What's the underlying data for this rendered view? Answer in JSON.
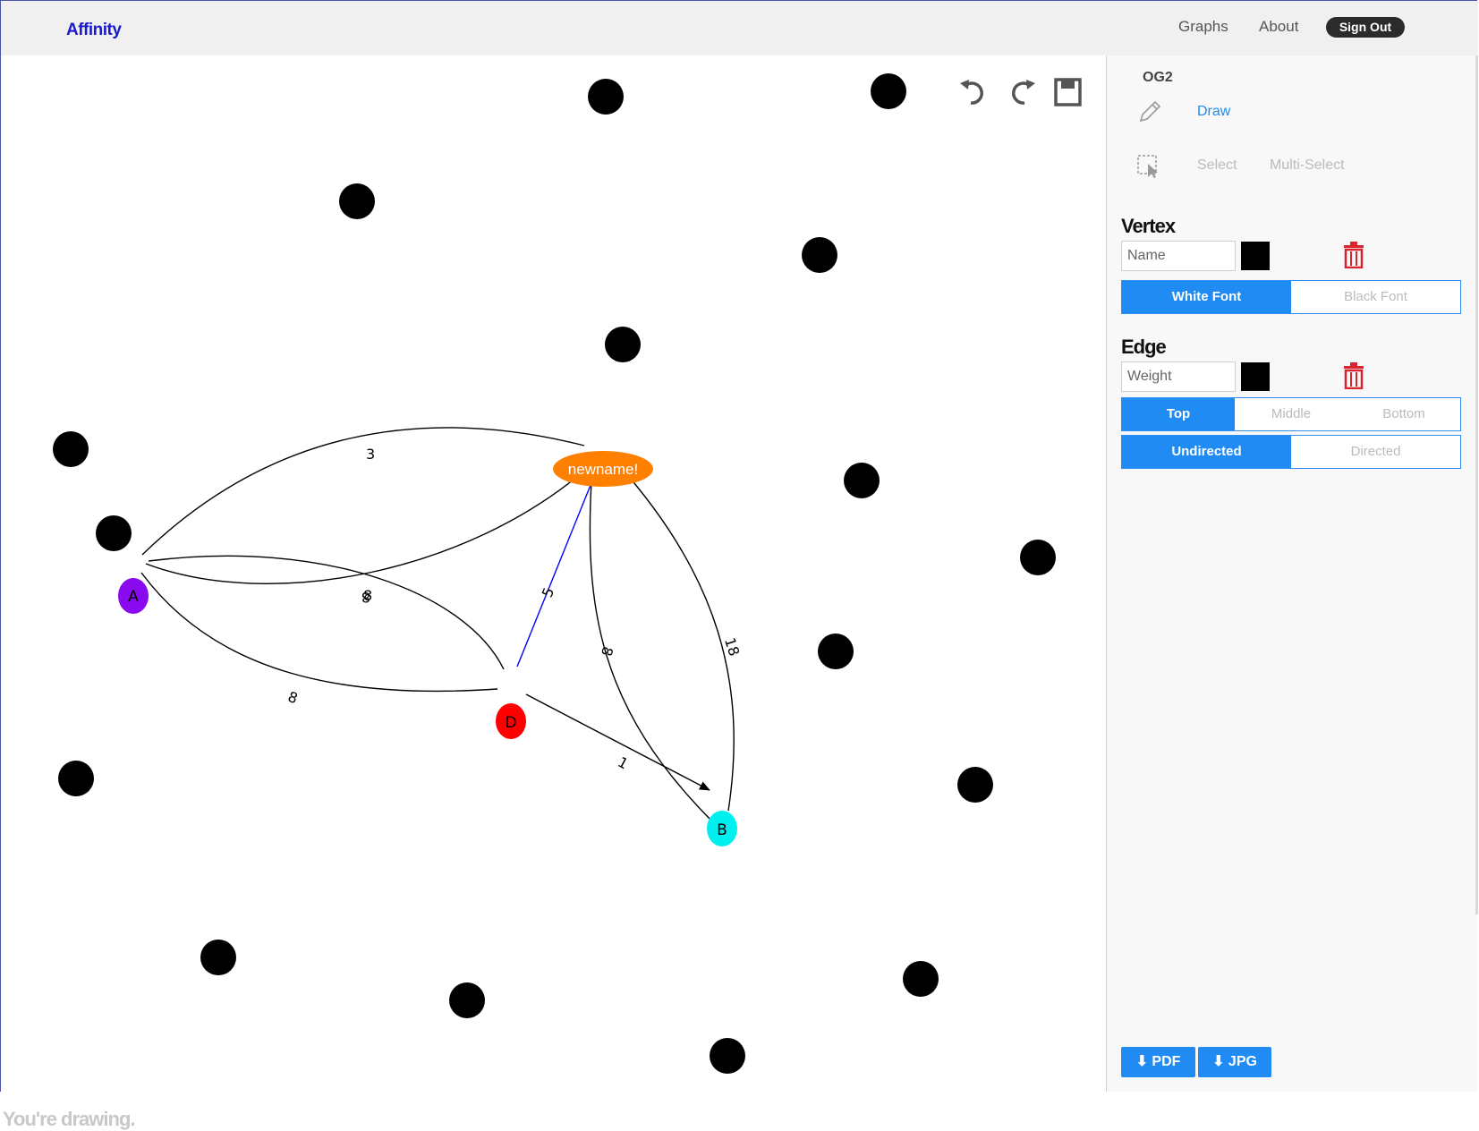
{
  "nav": {
    "brand": "Affinity",
    "links": [
      "Graphs",
      "About"
    ],
    "sign_out": "Sign Out"
  },
  "canvas": {
    "status": "You're drawing.",
    "toolbar": {
      "undo": "undo-icon",
      "redo": "redo-icon",
      "save": "save-icon"
    }
  },
  "panel": {
    "graph_name": "OG2",
    "modes": {
      "draw": "Draw",
      "select": "Select",
      "multi_select": "Multi-Select"
    },
    "vertex": {
      "title": "Vertex",
      "name_placeholder": "Name",
      "font_options": [
        "White Font",
        "Black Font"
      ],
      "selected_font": "White Font"
    },
    "edge": {
      "title": "Edge",
      "weight_placeholder": "Weight",
      "position_options": [
        "Top",
        "Middle",
        "Bottom"
      ],
      "selected_position": "Top",
      "direction_options": [
        "Undirected",
        "Directed"
      ],
      "selected_direction": "Undirected"
    },
    "downloads": [
      "PDF",
      "JPG"
    ]
  },
  "colors": {
    "accent": "#1f8bf3",
    "brand": "#1a1acc",
    "trash": "#d9232e",
    "vertex_A": "#8a0af0",
    "vertex_D": "#ff0000",
    "vertex_B": "#00f0f0",
    "vertex_newname": "#ff7f00",
    "directed_edge": "#0000ff"
  },
  "graph": {
    "labeled_vertices": [
      {
        "id": "A",
        "label": "A"
      },
      {
        "id": "D",
        "label": "D"
      },
      {
        "id": "B",
        "label": "B"
      },
      {
        "id": "N",
        "label": "newname!"
      }
    ],
    "edge_weights": {
      "A_N_top": "3",
      "A_N_bottom": "8",
      "A_D_top": "8",
      "A_D_bottom": "8",
      "D_N": "5",
      "B_N_inner": "8",
      "N_B_outer": "18",
      "D_B": "1"
    }
  }
}
